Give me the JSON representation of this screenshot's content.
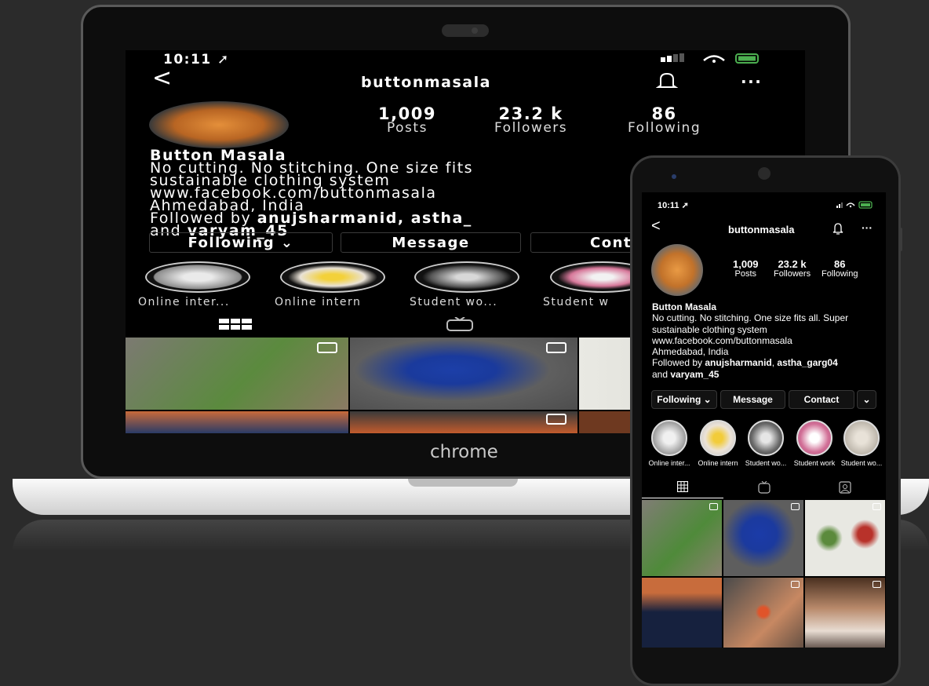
{
  "laptop": {
    "brand_label": "chrome",
    "status": {
      "time": "10:11"
    },
    "profile": {
      "username": "buttonmasala",
      "stats": [
        {
          "value": "1,009",
          "label": "Posts"
        },
        {
          "value": "23.2 k",
          "label": "Followers"
        },
        {
          "value": "86",
          "label": "Following"
        }
      ],
      "bio": {
        "name": "Button Masala",
        "line1": "No cutting. No stitching. One size fits",
        "line2": "sustainable clothing system",
        "link": "www.facebook.com/buttonmasala",
        "location": "Ahmedabad, India",
        "followed_prefix": "Followed by ",
        "followed_names": "anujsharmanid, astha_",
        "followed_and": "and ",
        "followed_last": "varyam_45"
      },
      "buttons": {
        "following": "Following",
        "message": "Message",
        "contact": "Cont"
      },
      "highlights": [
        "Online inter...",
        "Online intern",
        "Student wo...",
        "Student w"
      ]
    }
  },
  "phone": {
    "status": {
      "time": "10:11"
    },
    "profile": {
      "username": "buttonmasala",
      "stats": [
        {
          "value": "1,009",
          "label": "Posts"
        },
        {
          "value": "23.2 k",
          "label": "Followers"
        },
        {
          "value": "86",
          "label": "Following"
        }
      ],
      "bio": {
        "name": "Button Masala",
        "line1": "No cutting. No stitching. One size fits all. Super",
        "line2": "sustainable clothing system",
        "link": "www.facebook.com/buttonmasala",
        "location": "Ahmedabad, India",
        "followed_prefix": "Followed by ",
        "followed_names": "anujsharmanid",
        "followed_sep": ", ",
        "followed_name2": "astha_garg04",
        "followed_and": "and ",
        "followed_last": "varyam_45"
      },
      "buttons": {
        "following": "Following",
        "message": "Message",
        "contact": "Contact"
      },
      "highlights": [
        "Online inter...",
        "Online intern",
        "Student wo...",
        "Student work",
        "Student wo..."
      ]
    }
  },
  "colors": {
    "background": "#2b2b2b",
    "screen": "#000000",
    "accent": "#e48f3a"
  }
}
